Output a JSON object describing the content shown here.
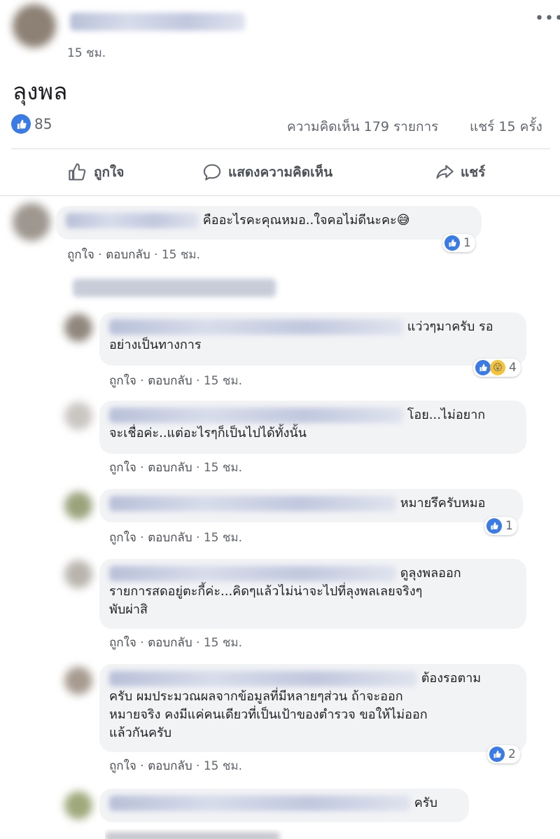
{
  "post": {
    "time": "15 ชม.",
    "title": "ลุงพล",
    "like_count": "85",
    "comment_summary": "ความคิดเห็น 179 รายการ",
    "share_summary": "แชร์ 15 ครั้ง",
    "more_icon": "more-horizontal-icon"
  },
  "toolbar": {
    "like_label": "ถูกใจ",
    "comment_label": "แสดงความคิดเห็น",
    "share_label": "แชร์"
  },
  "comment_actions": {
    "like": "ถูกใจ",
    "reply": "ตอบกลับ",
    "separator": "·"
  },
  "comments": [
    {
      "text": "คืออะไรคะคุณหมอ..ใจคอไม่ดีนะคะ😅",
      "time": "15 ชม.",
      "reactions": "1"
    },
    {
      "text": "แว่วๆมาครับ รอ",
      "text2": "อย่างเป็นทางการ",
      "time": "15 ชม.",
      "reactions": "4"
    },
    {
      "text": "โอย...ไม่อยาก",
      "text2": "จะเชื่อค่ะ..แต่อะไรๆก็เป็นไปได้ทั้งนั้น",
      "time": "15 ชม."
    },
    {
      "text": "หมายรึครับหมอ",
      "time": "15 ชม.",
      "reactions": "1"
    },
    {
      "text": "ดูลุงพลออก",
      "text2": "รายการสดอยู่ตะกี้ค่ะ...คิดๆแล้วไม่น่าจะไปที่ลุงพลเลยจริงๆ",
      "text3": "พับผ่าสิ",
      "time": "15 ชม."
    },
    {
      "text": "ต้องรอตาม",
      "text2": "ครับ ผมประมวณผลจากข้อมูลที่มีหลายๆส่วน ถ้าจะออก",
      "text3": "หมายจริง คงมีแค่คนเดียวที่เป็นเป้าของตำรวจ ขอให้ไม่ออก",
      "text4": "แล้วกันครับ",
      "time": "15 ชม.",
      "reactions": "2"
    },
    {
      "text": "ครับ"
    }
  ]
}
